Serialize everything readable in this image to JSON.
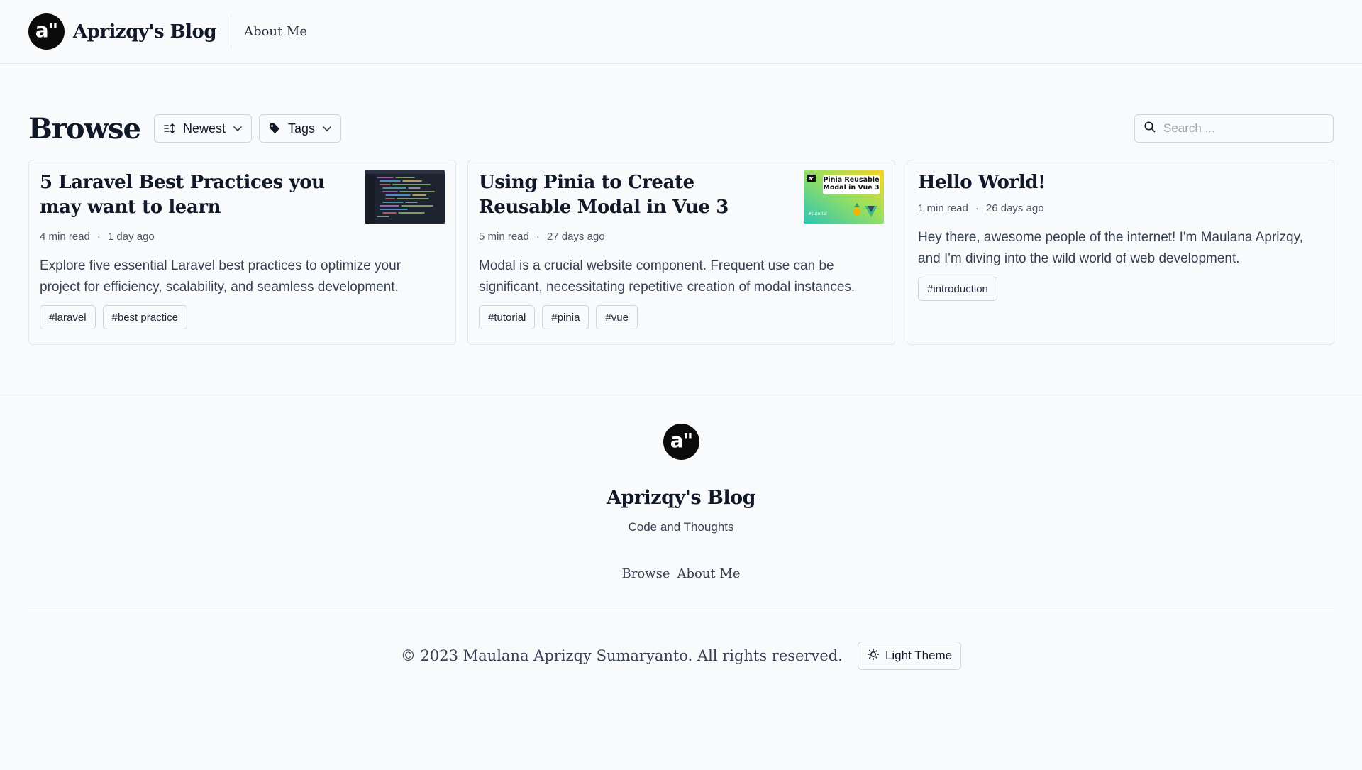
{
  "header": {
    "logo_text": "a\"",
    "brand": "Aprizqy's Blog",
    "nav": [
      {
        "label": "About Me"
      }
    ]
  },
  "browse": {
    "title": "Browse",
    "sort_label": "Newest",
    "tags_label": "Tags",
    "search_placeholder": "Search ..."
  },
  "posts": [
    {
      "title": "5 Laravel Best Practices you may want to learn",
      "read_time": "4 min read",
      "date": "1 day ago",
      "excerpt": "Explore five essential Laravel best practices to optimize your project for efficiency, scalability, and seamless development.",
      "tags": [
        "#laravel",
        "#best practice"
      ],
      "thumbnail": "code-editor"
    },
    {
      "title": "Using Pinia to Create Reusable Modal in Vue 3",
      "read_time": "5 min read",
      "date": "27 days ago",
      "excerpt": "Modal is a crucial website component. Frequent use can be significant, necessitating repetitive creation of modal instances.",
      "tags": [
        "#tutorial",
        "#pinia",
        "#vue"
      ],
      "thumbnail": "pinia-vue",
      "thumb_text": {
        "badge": "a\"",
        "headline": "Pinia Reusable Modal in Vue 3",
        "tag": "#tutorial"
      }
    },
    {
      "title": "Hello World!",
      "read_time": "1 min read",
      "date": "26 days ago",
      "excerpt": "Hey there, awesome people of the internet! I'm Maulana Aprizqy, and I'm diving into the wild world of web development.",
      "tags": [
        "#introduction"
      ]
    }
  ],
  "footer": {
    "logo_text": "a\"",
    "title": "Aprizqy's Blog",
    "tagline": "Code and Thoughts",
    "links": [
      "Browse",
      "About Me"
    ],
    "copyright": "© 2023 Maulana Aprizqy Sumaryanto. All rights reserved.",
    "theme_label": "Light Theme"
  },
  "colors": {
    "background": "#f8fafc",
    "text": "#111827",
    "border": "#e5e7eb"
  }
}
